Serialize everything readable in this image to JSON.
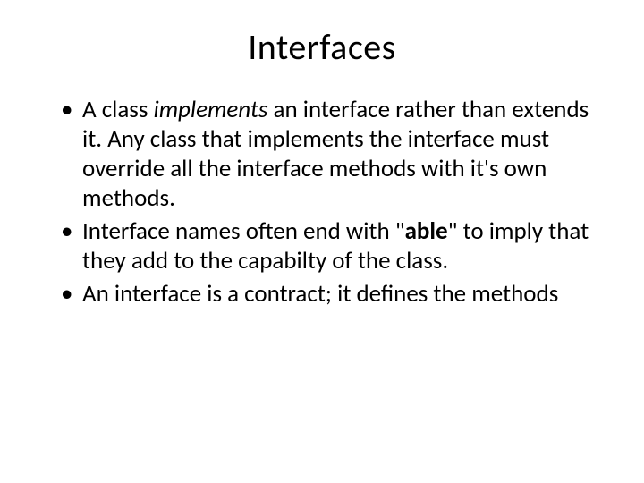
{
  "slide": {
    "title": "Interfaces",
    "bullets": [
      {
        "pre": "A class ",
        "em": "implements",
        "post": " an interface rather than extends it. Any class that implements the interface must override all the interface methods with it's own methods."
      },
      {
        "pre": "Interface names often end with \"",
        "em": "able",
        "post": "\" to imply that they add to the capabilty of the class."
      },
      {
        "pre": "An interface is a contract; it defines the methods",
        "em": "",
        "post": ""
      }
    ]
  }
}
